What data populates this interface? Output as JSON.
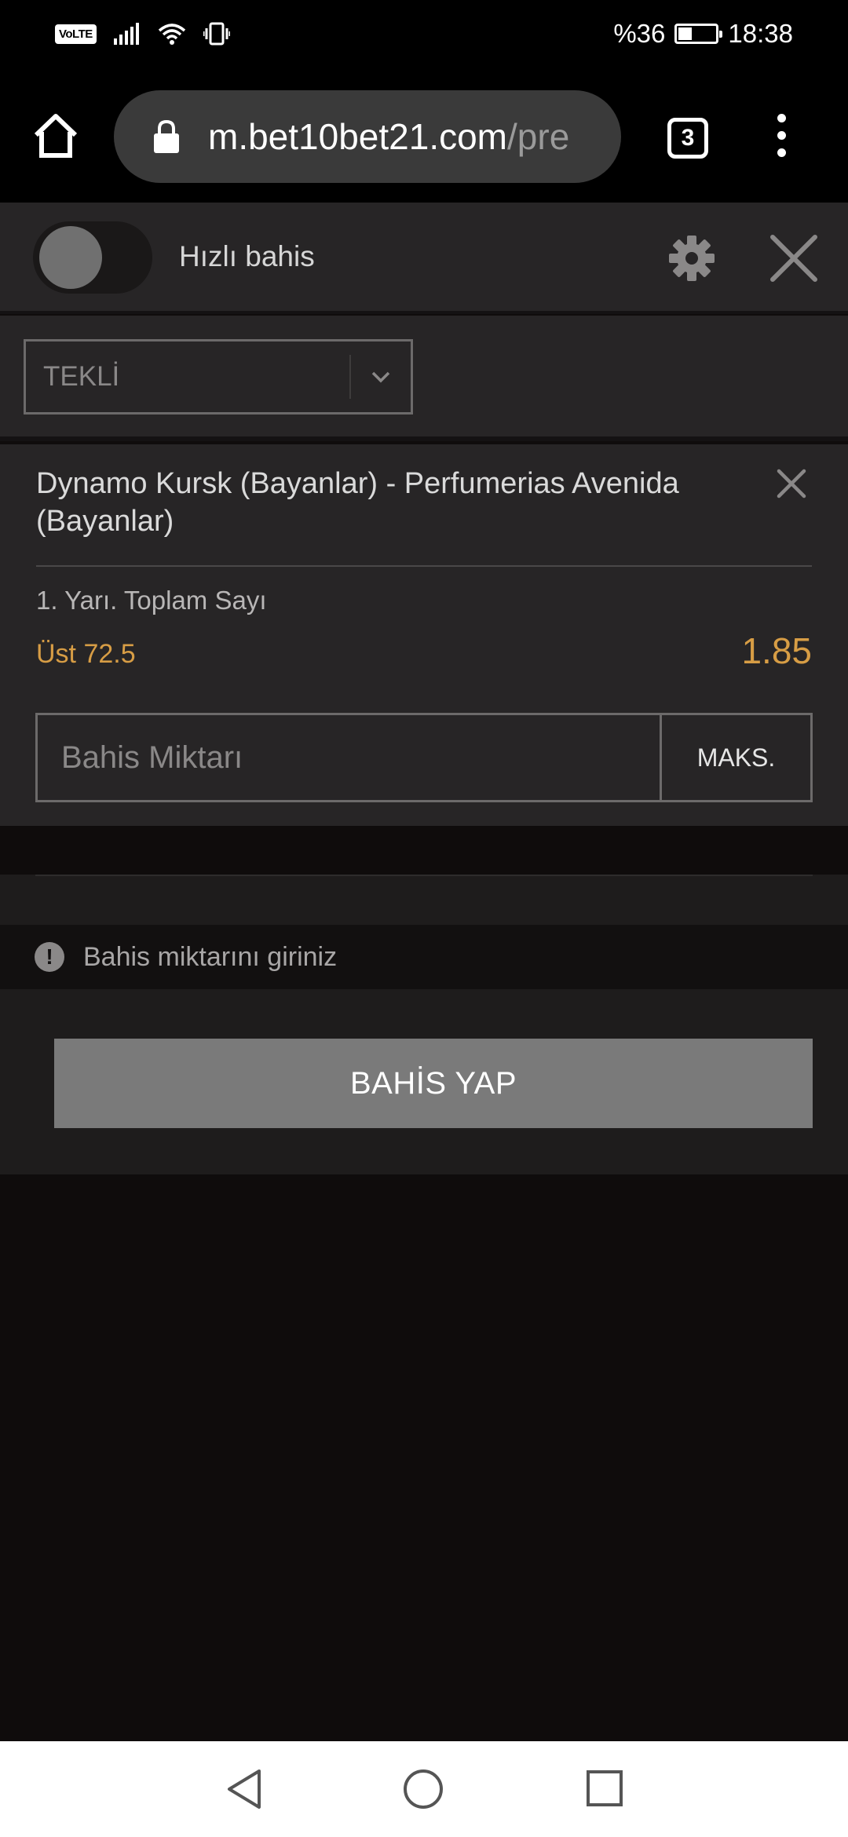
{
  "status_bar": {
    "volte": "VoLTE",
    "battery": "%36",
    "time": "18:38",
    "icons": [
      "signal-icon",
      "wifi-icon",
      "vibrate-icon",
      "battery-charging-icon"
    ]
  },
  "browser": {
    "url_domain": "m.bet10bet21.com",
    "url_path": "/pre",
    "tab_count": "3",
    "icons": [
      "home-icon",
      "lock-icon",
      "tabs-icon",
      "menu-icon"
    ]
  },
  "betslip": {
    "quick_bet_label": "Hızlı bahis",
    "quick_bet_enabled": false,
    "bet_type": "TEKLİ",
    "icons": [
      "gear-icon",
      "close-icon",
      "chevron-down-icon"
    ]
  },
  "bet": {
    "match": "Dynamo Kursk (Bayanlar) - Perfumerias Avenida (Bayanlar)",
    "market": "1. Yarı. Toplam Sayı",
    "selection": "Üst 72.5",
    "odds": "1.85",
    "stake_placeholder": "Bahis Miktarı",
    "max_label": "MAKS."
  },
  "warning": {
    "text": "Bahis miktarını giriniz",
    "icon": "!"
  },
  "action": {
    "place_bet_label": "BAHİS YAP"
  },
  "colors": {
    "accent_odds": "#d79d45",
    "panel_bg": "#272526",
    "page_bg": "#0f0c0c",
    "button_disabled": "#7a7a7a"
  }
}
